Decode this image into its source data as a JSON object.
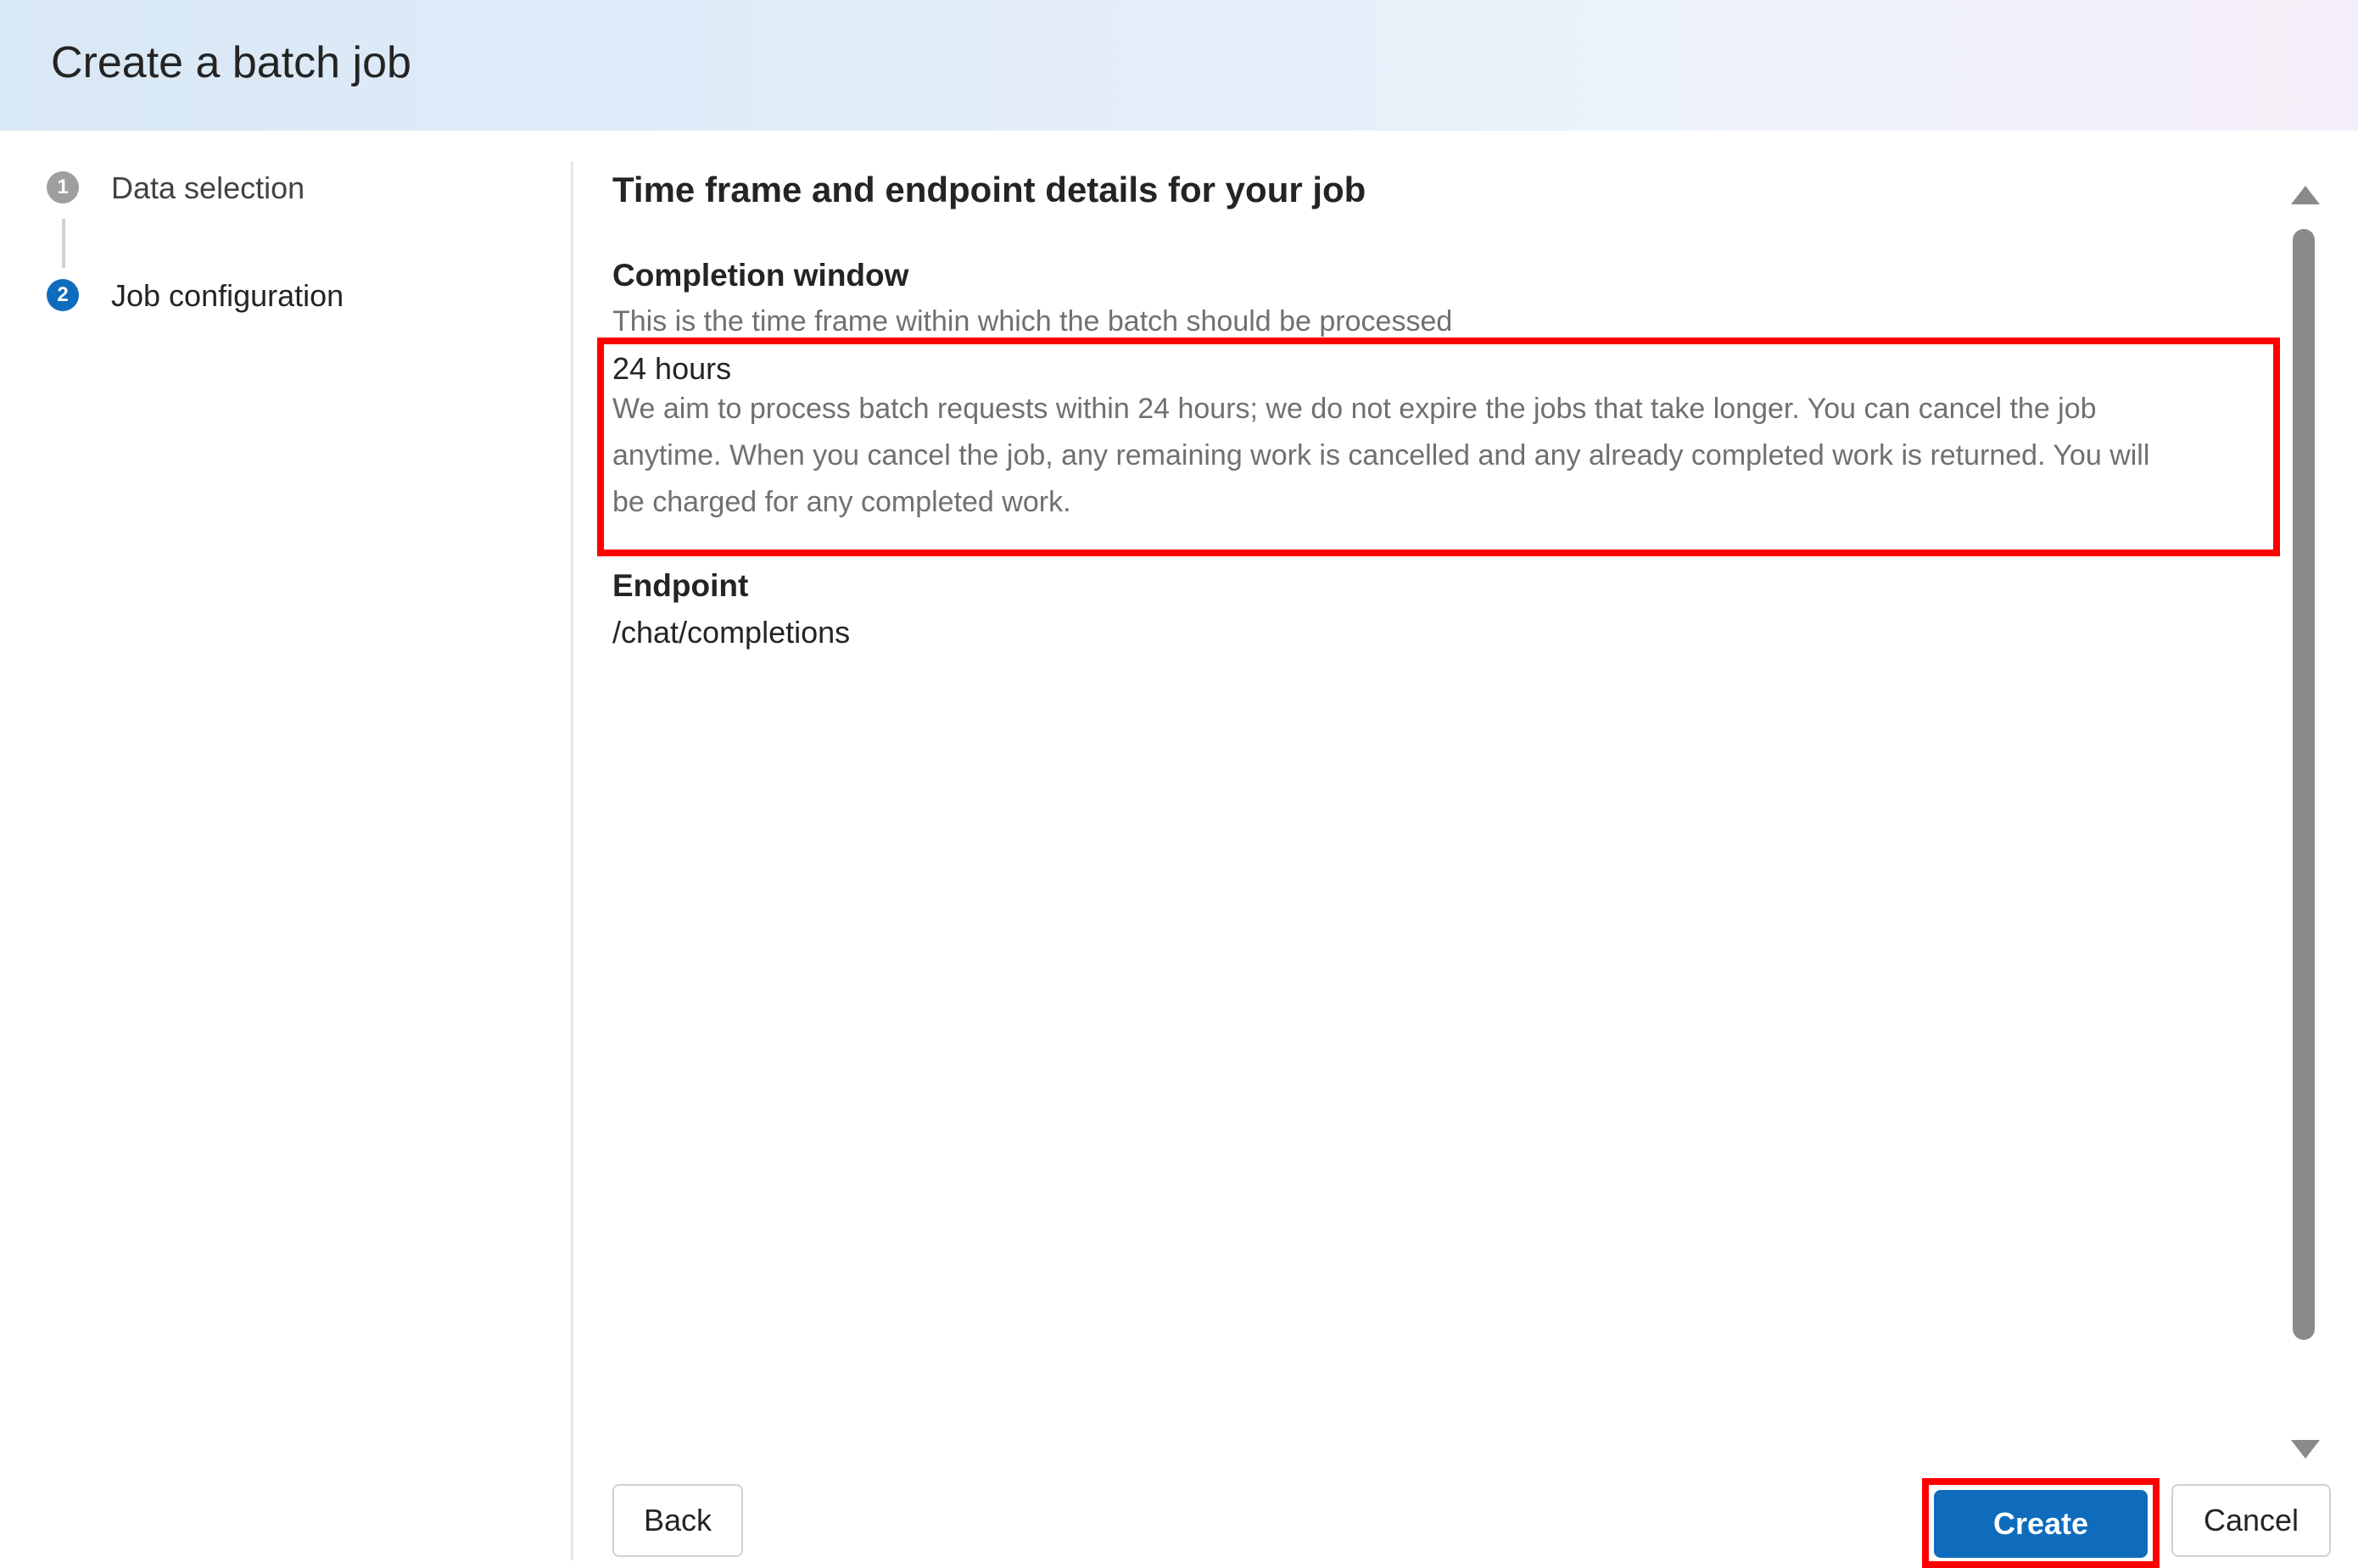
{
  "dialog": {
    "title": "Create a batch job"
  },
  "stepper": {
    "steps": [
      {
        "number": "1",
        "label": "Data selection",
        "state": "completed"
      },
      {
        "number": "2",
        "label": "Job configuration",
        "state": "active"
      }
    ]
  },
  "main": {
    "section_title": "Time frame and endpoint details for your job",
    "completion_window": {
      "label": "Completion window",
      "help_text": "This is the time frame within which the batch should be processed",
      "value": "24 hours",
      "description_lines": [
        "We aim to process batch requests within 24 hours; we do not expire the jobs that take longer. You can cancel the job",
        "anytime. When you cancel the job, any remaining work is cancelled and any already completed work is returned. You will",
        "be charged for any completed work."
      ]
    },
    "endpoint": {
      "label": "Endpoint",
      "value": "/chat/completions"
    }
  },
  "footer": {
    "back_label": "Back",
    "create_label": "Create",
    "cancel_label": "Cancel"
  },
  "colors": {
    "accent": "#0f6cbd",
    "highlight": "#ff0000",
    "muted_text": "#707070"
  },
  "icons": {
    "scroll_up": "triangle-up-icon",
    "scroll_down": "triangle-down-icon"
  }
}
